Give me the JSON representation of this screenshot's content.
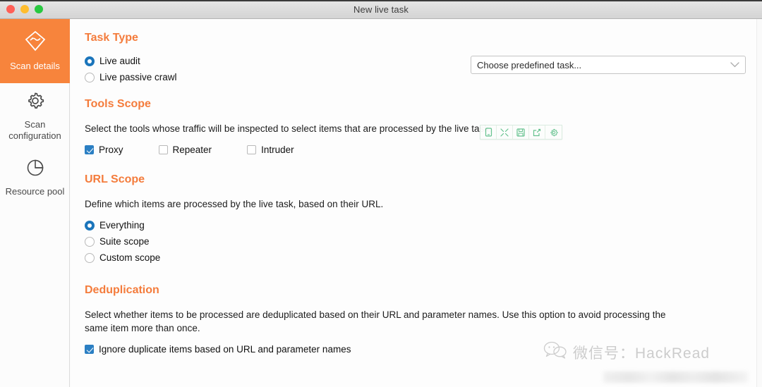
{
  "window": {
    "title": "New live task",
    "traffic_lights": [
      "close",
      "minimize",
      "maximize"
    ]
  },
  "sidebar": {
    "items": [
      {
        "label": "Scan details",
        "icon": "scan-kite-icon",
        "active": true
      },
      {
        "label": "Scan configuration",
        "icon": "gear-icon",
        "active": false
      },
      {
        "label": "Resource pool",
        "icon": "pie-chart-icon",
        "active": false
      }
    ]
  },
  "predefined_task": {
    "value": "Choose predefined task...",
    "icon": "chevron-down-icon"
  },
  "mini_toolbar": {
    "buttons": [
      {
        "icon": "mobile-icon"
      },
      {
        "icon": "expand-icon"
      },
      {
        "icon": "save-icon"
      },
      {
        "icon": "share-icon"
      },
      {
        "icon": "gear-icon"
      }
    ]
  },
  "sections": {
    "task_type": {
      "title": "Task Type",
      "options": [
        {
          "label": "Live audit",
          "selected": true
        },
        {
          "label": "Live passive crawl",
          "selected": false
        }
      ]
    },
    "tools_scope": {
      "title": "Tools Scope",
      "description": "Select the tools whose traffic will be inspected to select items that are processed by the live task.",
      "checkboxes": [
        {
          "label": "Proxy",
          "checked": true
        },
        {
          "label": "Repeater",
          "checked": false
        },
        {
          "label": "Intruder",
          "checked": false
        }
      ]
    },
    "url_scope": {
      "title": "URL Scope",
      "description": "Define which items are processed by the live task, based on their URL.",
      "options": [
        {
          "label": "Everything",
          "selected": true
        },
        {
          "label": "Suite scope",
          "selected": false
        },
        {
          "label": "Custom scope",
          "selected": false
        }
      ]
    },
    "deduplication": {
      "title": "Deduplication",
      "description": "Select whether items to be processed are deduplicated based on their URL and parameter names. Use this option to avoid processing the same item more than once.",
      "checkboxes": [
        {
          "label": "Ignore duplicate items based on URL and parameter names",
          "checked": true
        }
      ]
    }
  },
  "watermark": {
    "text": "微信号：HackRead",
    "icon": "wechat-icon"
  },
  "colors": {
    "accent_orange": "#f47c3c",
    "sidebar_active": "#f7843c",
    "control_blue": "#1b75bb",
    "checkbox_blue": "#2b7fc3",
    "toolbar_green": "#5fc08a"
  }
}
